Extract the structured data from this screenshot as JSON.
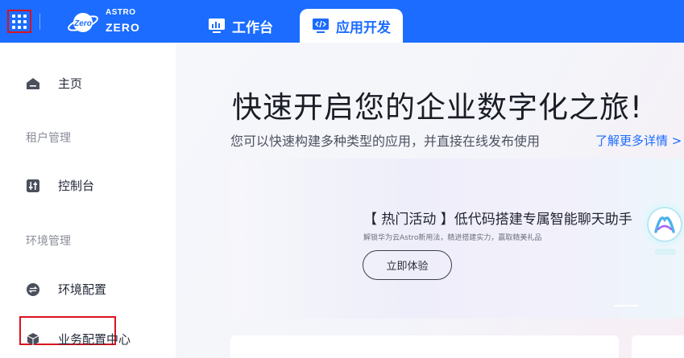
{
  "header": {
    "logo": {
      "line1": "ASTRO",
      "line2": "ZERO",
      "badge": "Zero"
    },
    "tabs": [
      {
        "label": "工作台",
        "icon": "monitor-chart-icon",
        "active": false
      },
      {
        "label": "应用开发",
        "icon": "code-screen-icon",
        "active": true
      }
    ],
    "colors": {
      "brand": "#1b6cff",
      "highlight": "#d9131e"
    }
  },
  "sidebar": {
    "items": [
      {
        "label": "主页",
        "icon": "home-icon"
      },
      {
        "label": "控制台",
        "icon": "sliders-icon"
      },
      {
        "label": "环境配置",
        "icon": "swap-icon"
      },
      {
        "label": "业务配置中心",
        "icon": "cube-icon"
      }
    ],
    "groups": [
      "租户管理",
      "环境管理"
    ]
  },
  "hero": {
    "title": "快速开启您的企业数字化之旅!",
    "subtitle": "您可以快速构建多种类型的应用，并直接在线发布使用",
    "link": "了解更多详情 >"
  },
  "banner": {
    "title": "【 热门活动 】低代码搭建专属智能聊天助手",
    "desc": "解锁华为云Astro新用法，精进搭建实力，赢取精美礼品",
    "button": "立即体验"
  }
}
